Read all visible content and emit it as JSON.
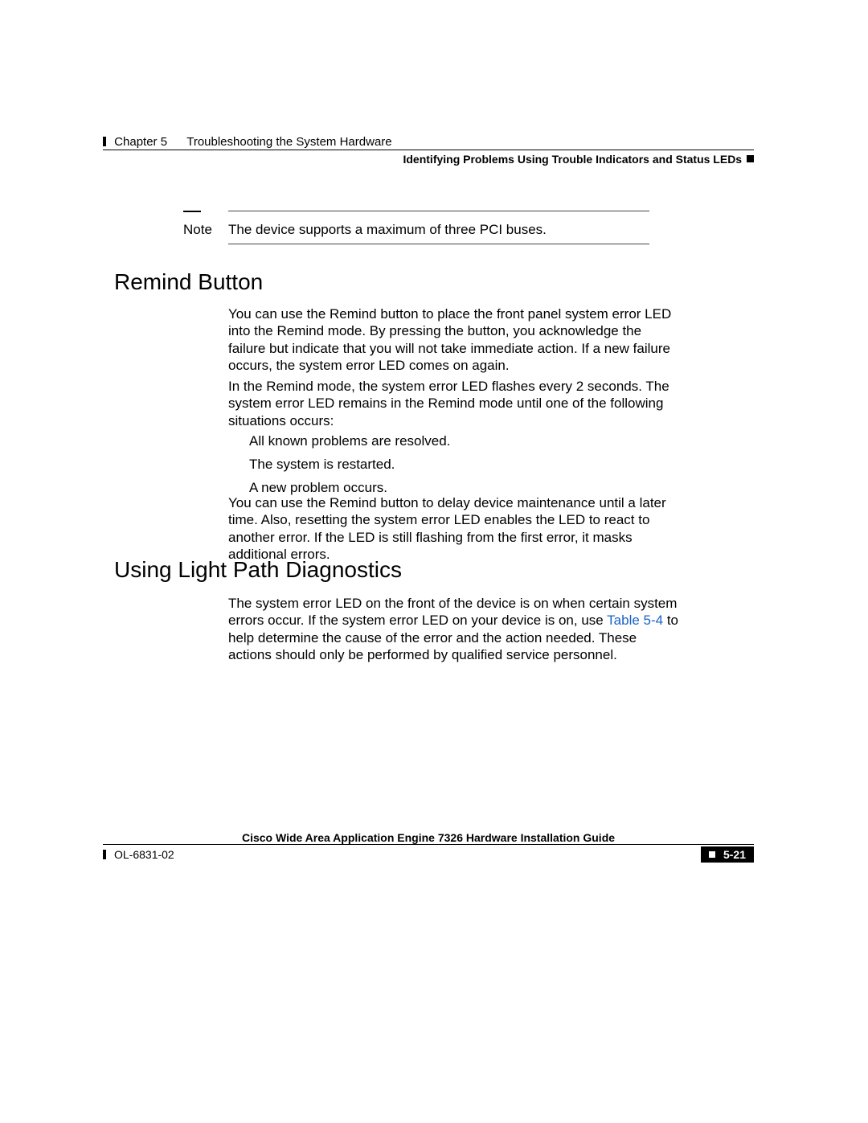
{
  "header": {
    "chapter": "Chapter 5",
    "chapter_title": "Troubleshooting the System Hardware",
    "subhead": "Identifying Problems Using Trouble Indicators and Status LEDs"
  },
  "note": {
    "label": "Note",
    "text": "The device supports a maximum of three PCI buses."
  },
  "sections": {
    "remind": {
      "heading": "Remind Button",
      "p1": "You can use the Remind button to place the front panel system error LED into the Remind mode. By pressing the button, you acknowledge the failure but indicate that you will not take immediate action. If a new failure occurs, the system error LED comes on again.",
      "p2": "In the Remind mode, the system error LED flashes every 2 seconds. The system error LED remains in the Remind mode until one of the following situations occurs:",
      "list": [
        "All known problems are resolved.",
        "The system is restarted.",
        "A new problem occurs."
      ],
      "p3": "You can use the Remind button to delay device maintenance until a later time. Also, resetting the system error LED enables the LED to react to another error. If the LED is still flashing from the first error, it masks additional errors."
    },
    "lightpath": {
      "heading": "Using Light Path Diagnostics",
      "p4_pre": "The system error LED on the front of the device is on when certain system errors occur. If the system error LED on your device is on, use ",
      "link": "Table 5-4",
      "p4_post": " to help determine the cause of the error and the action needed. These actions should only be performed by qualified service personnel."
    }
  },
  "footer": {
    "title": "Cisco Wide Area Application Engine 7326 Hardware Installation Guide",
    "doc_id": "OL-6831-02",
    "page": "5-21"
  }
}
